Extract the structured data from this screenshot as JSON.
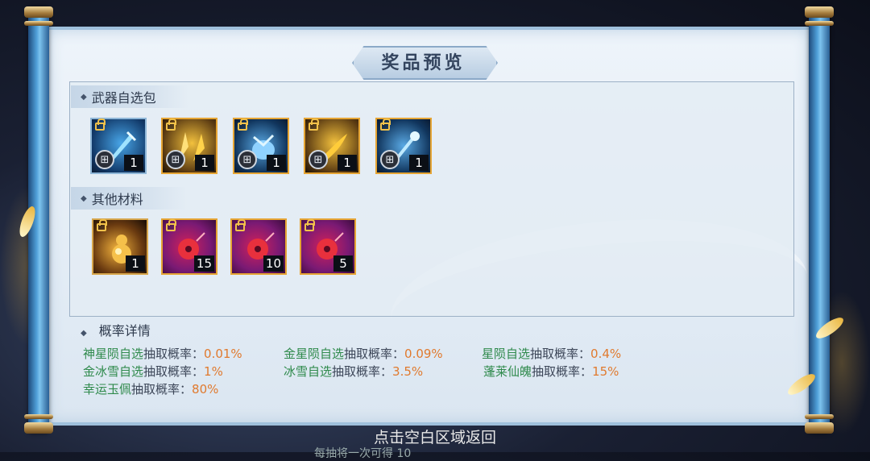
{
  "title": "奖品预览",
  "sections": [
    {
      "label": "武器自选包",
      "items": [
        {
          "qty": "1",
          "style": "blue",
          "icon": "blue-sword-icon",
          "locked": true,
          "gift": true
        },
        {
          "qty": "1",
          "style": "gold",
          "icon": "golden-blades-icon",
          "locked": true,
          "gift": true
        },
        {
          "qty": "1",
          "style": "gold2",
          "icon": "ice-claw-icon",
          "locked": true,
          "gift": true
        },
        {
          "qty": "1",
          "style": "gold",
          "icon": "fire-blade-icon",
          "locked": true,
          "gift": true
        },
        {
          "qty": "1",
          "style": "gold2",
          "icon": "ice-staff-icon",
          "locked": true,
          "gift": true
        }
      ]
    },
    {
      "label": "其他材料",
      "items": [
        {
          "qty": "1",
          "style": "bronze",
          "icon": "golden-gourd-icon",
          "locked": true,
          "gift": false
        },
        {
          "qty": "15",
          "style": "purple",
          "icon": "jade-pendant-icon",
          "locked": true,
          "gift": false
        },
        {
          "qty": "10",
          "style": "purple",
          "icon": "jade-pendant-icon",
          "locked": true,
          "gift": false
        },
        {
          "qty": "5",
          "style": "purple",
          "icon": "jade-pendant-icon",
          "locked": true,
          "gift": false
        }
      ]
    }
  ],
  "probability": {
    "title": "概率详情",
    "rows": [
      {
        "name": "神星陨自选",
        "key": "抽取概率：",
        "value": "0.01%"
      },
      {
        "name": "金星陨自选",
        "key": "抽取概率：",
        "value": "0.09%"
      },
      {
        "name": "星陨自选",
        "key": "抽取概率：",
        "value": "0.4%"
      },
      {
        "name": "金冰雪自选",
        "key": "抽取概率：",
        "value": "1%"
      },
      {
        "name": "冰雪自选",
        "key": "抽取概率：",
        "value": "3.5%"
      },
      {
        "name": "蓬莱仙魄",
        "key": "抽取概率：",
        "value": "15%"
      },
      {
        "name": "幸运玉佩",
        "key": "抽取概率：",
        "value": "80%"
      }
    ]
  },
  "hint": "点击空白区域返回",
  "hint_partial": "每抽将一次可得 10",
  "colors": {
    "name_green": "#2f8a4c",
    "value_orange": "#e07a2e",
    "paper": "#e4edf6",
    "rod": "#4f9fd8"
  }
}
